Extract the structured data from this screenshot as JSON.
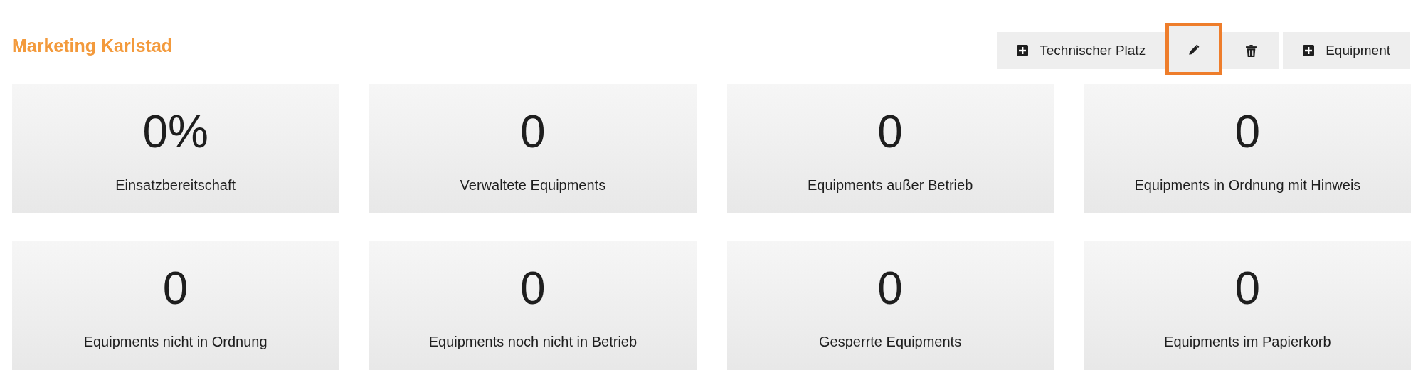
{
  "title": "Marketing Karlstad",
  "toolbar": [
    {
      "kind": "add",
      "label": "Technischer Platz",
      "highlighted": false
    },
    {
      "kind": "edit",
      "highlighted": true
    },
    {
      "kind": "delete",
      "highlighted": false
    },
    {
      "kind": "add",
      "label": "Equipment",
      "highlighted": false
    }
  ],
  "stats": [
    {
      "value": "0%",
      "label": "Einsatzbereitschaft"
    },
    {
      "value": "0",
      "label": "Verwaltete Equipments"
    },
    {
      "value": "0",
      "label": "Equipments außer Betrieb"
    },
    {
      "value": "0",
      "label": "Equipments in Ordnung mit Hinweis"
    },
    {
      "value": "0",
      "label": "Equipments nicht in Ordnung"
    },
    {
      "value": "0",
      "label": "Equipments noch nicht in Betrieb"
    },
    {
      "value": "0",
      "label": "Gesperrte Equipments"
    },
    {
      "value": "0",
      "label": "Equipments im Papierkorb"
    }
  ]
}
